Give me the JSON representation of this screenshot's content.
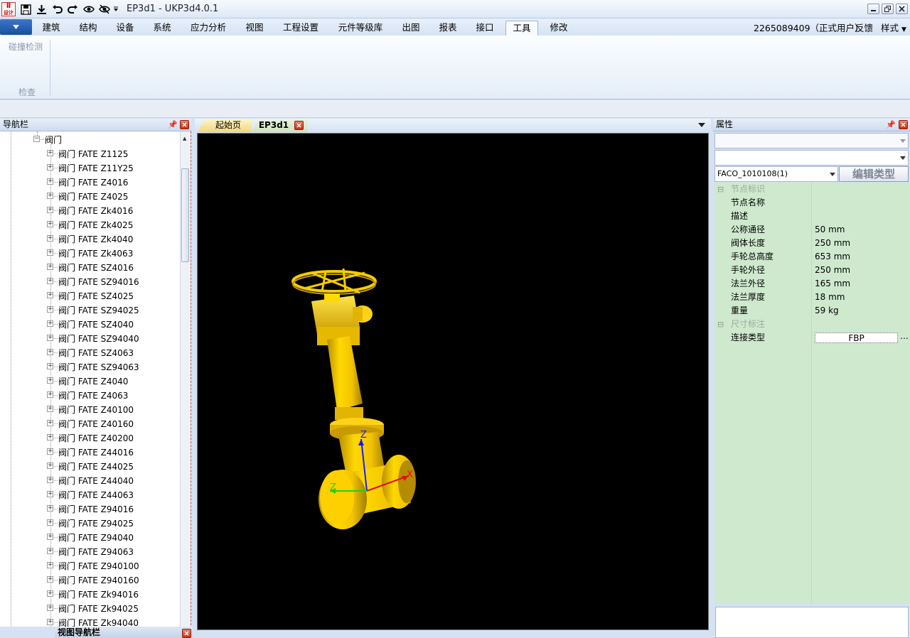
{
  "window": {
    "title": "EP3d1 - UKP3d4.0.1",
    "logo_text": "ⅡⅡ\n设计",
    "quick_access": [
      "save-icon",
      "save-as-icon",
      "undo-icon",
      "redo-icon",
      "eye-icon",
      "hide-eye-icon",
      "dropdown-icon"
    ]
  },
  "menu": {
    "tabs": [
      "建筑",
      "结构",
      "设备",
      "系统",
      "应力分析",
      "视图",
      "工程设置",
      "元件等级库",
      "出图",
      "报表",
      "接口",
      "工具",
      "修改"
    ],
    "active_tab": "工具",
    "user": "2265089409（正式用户）",
    "feedback": "反馈",
    "style": "样式"
  },
  "ribbon": {
    "collision_button": "碰撞检测",
    "group_label": "检查"
  },
  "nav_panel": {
    "title": "导航栏",
    "root_item": "阀门",
    "items": [
      "阀门 FATE Z1125",
      "阀门 FATE Z11Y25",
      "阀门 FATE Z4016",
      "阀门 FATE Z4025",
      "阀门 FATE Zk4016",
      "阀门 FATE Zk4025",
      "阀门 FATE Zk4040",
      "阀门 FATE Zk4063",
      "阀门 FATE SZ4016",
      "阀门 FATE SZ94016",
      "阀门 FATE SZ4025",
      "阀门 FATE SZ94025",
      "阀门 FATE SZ4040",
      "阀门 FATE SZ94040",
      "阀门 FATE SZ4063",
      "阀门 FATE SZ94063",
      "阀门 FATE Z4040",
      "阀门 FATE Z4063",
      "阀门 FATE Z40100",
      "阀门 FATE Z40160",
      "阀门 FATE Z40200",
      "阀门 FATE Z44016",
      "阀门 FATE Z44025",
      "阀门 FATE Z44040",
      "阀门 FATE Z44063",
      "阀门 FATE Z94016",
      "阀门 FATE Z94025",
      "阀门 FATE Z94040",
      "阀门 FATE Z94063",
      "阀门 FATE Z940100",
      "阀门 FATE Z940160",
      "阀门 FATE Zk94016",
      "阀门 FATE Zk94025",
      "阀门 FATE Zk94040"
    ],
    "view_nav_title": "视图导航栏"
  },
  "documents": {
    "tabs": [
      "起始页",
      "EP3d1"
    ],
    "active": "EP3d1"
  },
  "viewport": {
    "axis_labels": {
      "z": "Z",
      "x": "X"
    },
    "model_color": "#f2c400",
    "background": "#000000"
  },
  "properties": {
    "title": "属性",
    "combo1": "",
    "combo2": "",
    "type_combo": "FACO_1010108(1)",
    "edit_type_button": "编辑类型",
    "categories": [
      {
        "name": "节点标识",
        "rows": [
          {
            "name": "节点名称",
            "value": ""
          },
          {
            "name": "描述",
            "value": ""
          },
          {
            "name": "公称通径",
            "value": "50 mm"
          },
          {
            "name": "阀体长度",
            "value": "250 mm"
          },
          {
            "name": "手轮总高度",
            "value": "653 mm"
          },
          {
            "name": "手轮外径",
            "value": "250 mm"
          },
          {
            "name": "法兰外径",
            "value": "165 mm"
          },
          {
            "name": "法兰厚度",
            "value": "18 mm"
          },
          {
            "name": "重量",
            "value": "59 kg"
          }
        ]
      },
      {
        "name": "尺寸标注",
        "rows": [
          {
            "name": "连接类型",
            "value": "FBP"
          }
        ]
      }
    ]
  },
  "colors": {
    "accent": "#1a4f9d",
    "grid_bg": "#cfe9cf",
    "close_red": "#c83018"
  }
}
